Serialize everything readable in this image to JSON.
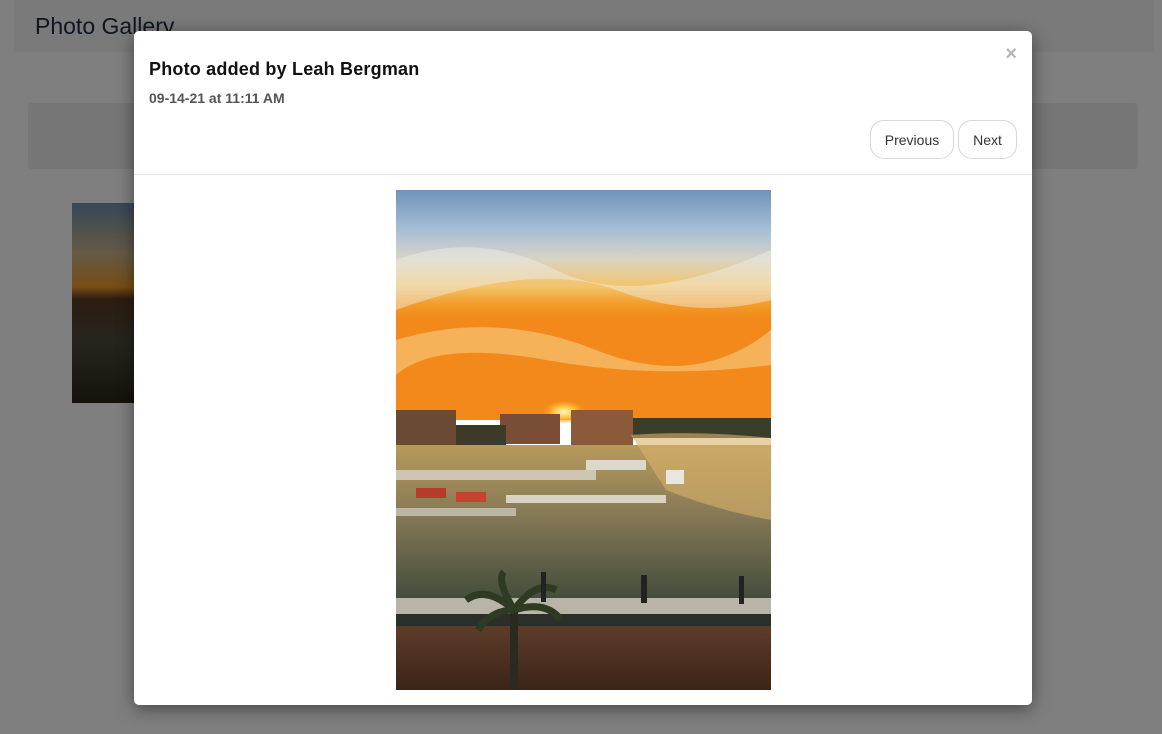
{
  "page": {
    "title": "Photo Gallery"
  },
  "modal": {
    "title": "Photo added by Leah Bergman",
    "date": "09-14-21 at 11:11 AM",
    "close_glyph": "×",
    "previous_label": "Previous",
    "next_label": "Next"
  },
  "photo": {
    "description_icon": "sunset-marina-photo"
  },
  "colors": {
    "title_text": "#1f2a44",
    "backdrop": "rgba(0,0,0,0.5)"
  }
}
